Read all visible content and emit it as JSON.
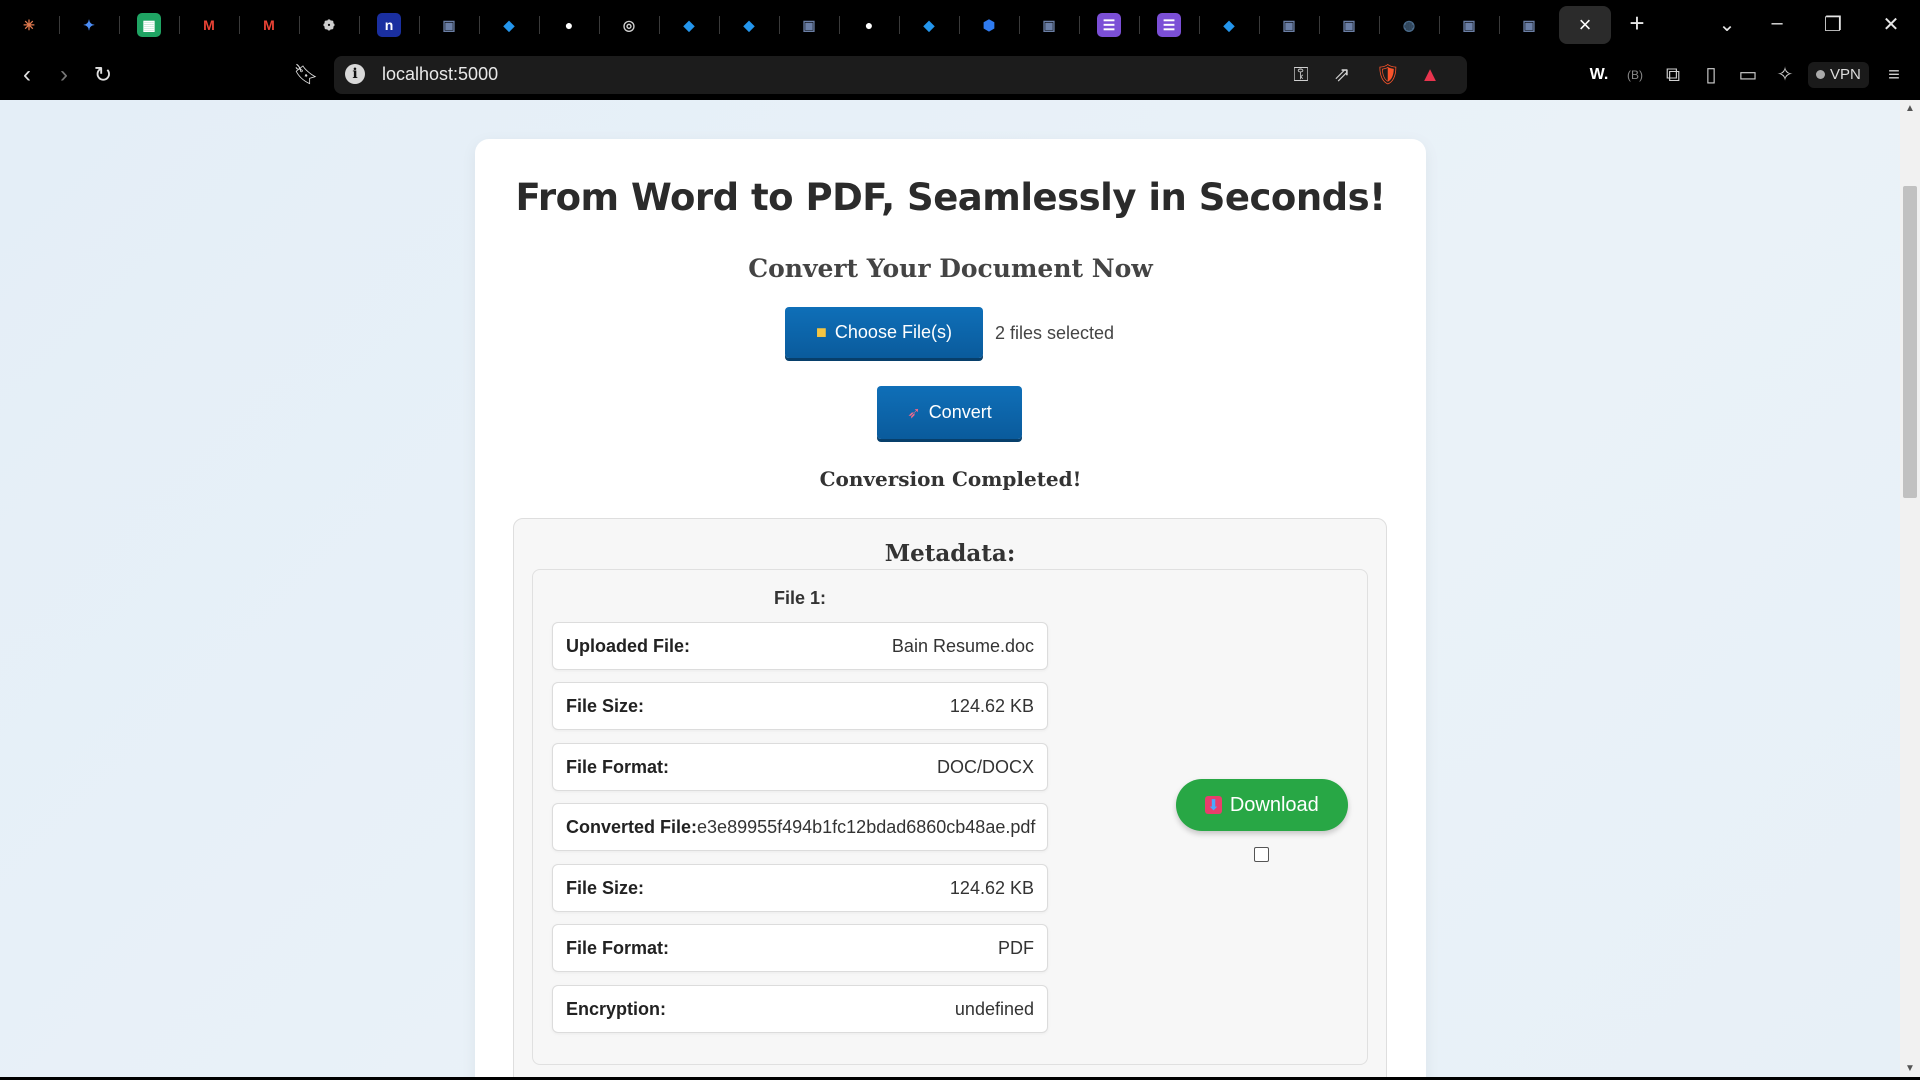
{
  "browser": {
    "url": "localhost:5000",
    "vpn_label": "VPN",
    "tabs": [
      {
        "icon": "claude-icon",
        "color": "#e07a4f"
      },
      {
        "icon": "gemini-icon",
        "color": "#4c8df5"
      },
      {
        "icon": "sheets-icon",
        "color": "#1fa463"
      },
      {
        "icon": "gmail-icon",
        "color": "#ea4335"
      },
      {
        "icon": "gmail-icon",
        "color": "#ea4335"
      },
      {
        "icon": "chatgpt-icon",
        "color": "#cfcfcf"
      },
      {
        "icon": "n-icon",
        "color": "#1a2fa0"
      },
      {
        "icon": "doc-icon",
        "color": "#6b7fa6"
      },
      {
        "icon": "docker-icon",
        "color": "#2496ed"
      },
      {
        "icon": "github-icon",
        "color": "#ffffff"
      },
      {
        "icon": "globe-icon",
        "color": "#cfcfcf"
      },
      {
        "icon": "docker-icon",
        "color": "#2496ed"
      },
      {
        "icon": "docker-icon",
        "color": "#2496ed"
      },
      {
        "icon": "doc-icon",
        "color": "#6b7fa6"
      },
      {
        "icon": "github-icon",
        "color": "#ffffff"
      },
      {
        "icon": "docker-icon",
        "color": "#2496ed"
      },
      {
        "icon": "shield-icon",
        "color": "#2f7bf0"
      },
      {
        "icon": "doc-icon",
        "color": "#6b7fa6"
      },
      {
        "icon": "list-icon",
        "color": "#7b4fd6"
      },
      {
        "icon": "list-icon",
        "color": "#7b4fd6"
      },
      {
        "icon": "docker-icon",
        "color": "#2496ed"
      },
      {
        "icon": "doc-icon",
        "color": "#6b7fa6"
      },
      {
        "icon": "doc-icon",
        "color": "#6b7fa6"
      },
      {
        "icon": "circle-icon",
        "color": "#4a6a8a"
      },
      {
        "icon": "doc-icon",
        "color": "#6b7fa6"
      },
      {
        "icon": "doc-icon",
        "color": "#6b7fa6"
      }
    ]
  },
  "page": {
    "title": "From Word to PDF, Seamlessly in Seconds!",
    "subtitle": "Convert Your Document Now",
    "choose_label": "Choose File(s)",
    "files_selected": "2 files selected",
    "convert_label": "Convert",
    "status": "Conversion Completed!",
    "metadata_title": "Metadata:",
    "file_heading": "File 1:",
    "rows": [
      {
        "k": "Uploaded File:",
        "v": "Bain Resume.doc"
      },
      {
        "k": "File Size:",
        "v": "124.62 KB"
      },
      {
        "k": "File Format:",
        "v": "DOC/DOCX"
      },
      {
        "k": "Converted File:",
        "v": "e3e89955f494b1fc12bdad6860cb48ae.pdf"
      },
      {
        "k": "File Size:",
        "v": "124.62 KB"
      },
      {
        "k": "File Format:",
        "v": "PDF"
      },
      {
        "k": "Encryption:",
        "v": "undefined"
      }
    ],
    "download_label": "Download",
    "colors": {
      "primary": "#0a5b9c",
      "success": "#28a745"
    }
  }
}
